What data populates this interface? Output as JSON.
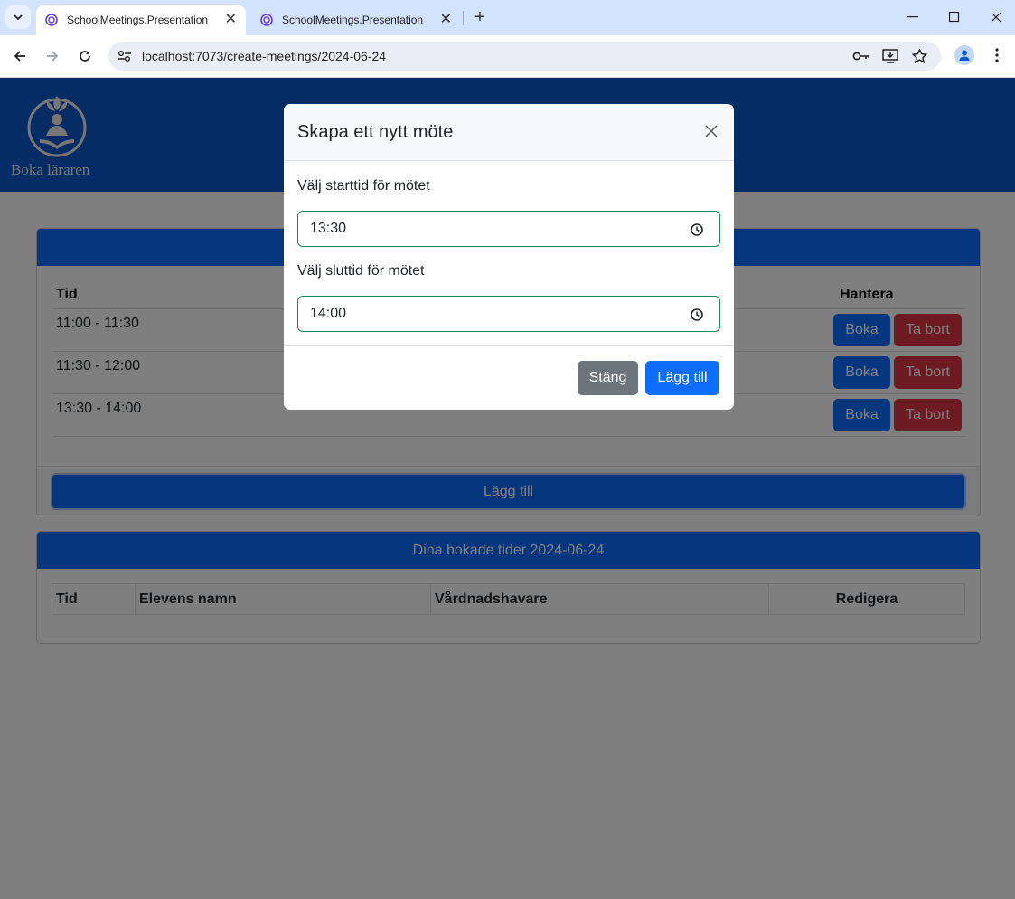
{
  "browser": {
    "tabs": [
      {
        "title": "SchoolMeetings.Presentation",
        "active": true
      },
      {
        "title": "SchoolMeetings.Presentation",
        "active": false
      }
    ],
    "url": "localhost:7073/create-meetings/2024-06-24"
  },
  "brand": {
    "name": "Boka läraren"
  },
  "slots_card": {
    "columns": {
      "time": "Tid",
      "manage": "Hantera"
    },
    "rows": [
      {
        "time": "11:00 - 11:30",
        "book": "Boka",
        "delete": "Ta bort"
      },
      {
        "time": "11:30 - 12:00",
        "book": "Boka",
        "delete": "Ta bort"
      },
      {
        "time": "13:30 - 14:00",
        "book": "Boka",
        "delete": "Ta bort"
      }
    ],
    "add_label": "Lägg till"
  },
  "booked_card": {
    "title": "Dina bokade tider 2024-06-24",
    "columns": [
      "Tid",
      "Elevens namn",
      "Vårdnadshavare",
      "Redigera"
    ]
  },
  "modal": {
    "title": "Skapa ett nytt möte",
    "start_label": "Välj starttid för mötet",
    "start_value": "13:30",
    "end_label": "Välj sluttid för mötet",
    "end_value": "14:00",
    "close_label": "Stäng",
    "add_label": "Lägg till"
  },
  "colors": {
    "primary": "#0d6efd",
    "danger": "#dc3545",
    "secondary": "#6c757d",
    "hero": "#0a58ca"
  }
}
